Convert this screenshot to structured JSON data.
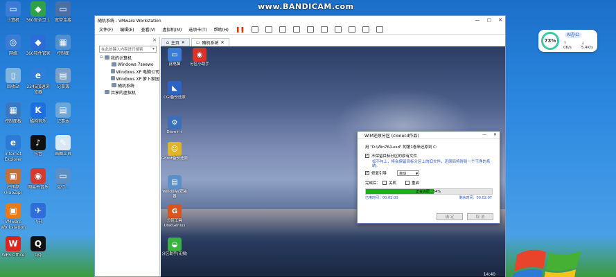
{
  "watermark": "www.BANDICAM.com",
  "desktop_icons": [
    {
      "label": "计算机",
      "icon": "computer-icon",
      "color": "#3a7bd5",
      "glyph": "▭"
    },
    {
      "label": "360安全卫士",
      "icon": "360-security-icon",
      "color": "#2fa14a",
      "glyph": "◆"
    },
    {
      "label": "宽带连接",
      "icon": "broadband-icon",
      "color": "#4a6fa5",
      "glyph": "▭"
    },
    {
      "label": "网络",
      "icon": "network-icon",
      "color": "#3a7bd5",
      "glyph": "◎"
    },
    {
      "label": "360软件管家",
      "icon": "360-software-icon",
      "color": "#2b6cd6",
      "glyph": "◆"
    },
    {
      "label": "控制面",
      "icon": "control-panel-icon",
      "color": "#4f8fd0",
      "glyph": "▦"
    },
    {
      "label": "回收站",
      "icon": "recycle-bin-icon",
      "color": "#7fb3e0",
      "glyph": "▯"
    },
    {
      "label": "2345加速浏览器",
      "icon": "browser-2345-icon",
      "color": "#2e7fd8",
      "glyph": "e"
    },
    {
      "label": "记事簿",
      "icon": "notebook-icon",
      "color": "#7aa0c8",
      "glyph": "▤"
    },
    {
      "label": "控制面板",
      "icon": "control-panel-icon",
      "color": "#3c78c2",
      "glyph": "▦"
    },
    {
      "label": "酷狗音乐",
      "icon": "kugou-icon",
      "color": "#1d6fe0",
      "glyph": "K"
    },
    {
      "label": "记事本",
      "icon": "notepad-icon",
      "color": "#6aa6d8",
      "glyph": "▤"
    },
    {
      "label": "Internet Explorer",
      "icon": "ie-icon",
      "color": "#2b7bd6",
      "glyph": "e"
    },
    {
      "label": "抖音",
      "icon": "tiktok-icon",
      "color": "#111111",
      "glyph": "♪"
    },
    {
      "label": "画图工具",
      "icon": "paint-icon",
      "color": "#d9e8f5",
      "glyph": "✎"
    },
    {
      "label": "好压缩(HaoZip)",
      "icon": "haozip-icon",
      "color": "#c2703a",
      "glyph": "▣"
    },
    {
      "label": "网易云音乐",
      "icon": "netease-music-icon",
      "color": "#d33a31",
      "glyph": "◉"
    },
    {
      "label": "运行…",
      "icon": "run-icon",
      "color": "#5a8fc8",
      "glyph": "▭"
    },
    {
      "label": "VMware Workstation",
      "icon": "vmware-icon",
      "color": "#e97a1a",
      "glyph": "▣"
    },
    {
      "label": "飞书",
      "icon": "feishu-icon",
      "color": "#2f6ed8",
      "glyph": "✈"
    },
    {
      "label": "WPS Office",
      "icon": "wps-icon",
      "color": "#d5271f",
      "glyph": "W"
    },
    {
      "label": "QQ",
      "icon": "qq-icon",
      "color": "#111111",
      "glyph": "Q"
    }
  ],
  "vmware": {
    "title": "随机系统 - VMware Workstation",
    "menu": [
      "文件(F)",
      "编辑(E)",
      "查看(V)",
      "虚拟机(M)",
      "选项卡(T)",
      "帮助(H)"
    ],
    "tabs": [
      "主页",
      "随机系统"
    ],
    "library": {
      "search_placeholder": "在此处键入内容进行搜索",
      "tree": [
        {
          "label": "我的计算机",
          "level": 0,
          "twisty": "⊟"
        },
        {
          "label": "Windows 7seewo",
          "level": 1,
          "twisty": ""
        },
        {
          "label": "Windows XP 电脑公司",
          "level": 1,
          "twisty": ""
        },
        {
          "label": "Windows XP 萝卜家园",
          "level": 1,
          "twisty": ""
        },
        {
          "label": "随机系统",
          "level": 1,
          "twisty": ""
        },
        {
          "label": "共享的虚拟机",
          "level": 0,
          "twisty": ""
        }
      ]
    }
  },
  "guest_icons": [
    {
      "label": "此电脑",
      "icon": "this-pc-icon",
      "color": "#3a7bd5",
      "glyph": "▭"
    },
    {
      "label": "分区小助手",
      "icon": "partition-assistant-icon",
      "color": "#d8332b",
      "glyph": "◉"
    },
    {
      "label": "CGI备份还原",
      "icon": "cgi-backup-icon",
      "color": "#2c64c4",
      "glyph": "◣"
    },
    {
      "label": "Dism++",
      "icon": "dism-icon",
      "color": "#3d6fb8",
      "glyph": "⚙"
    },
    {
      "label": "Ghost备份还原",
      "icon": "ghost-icon",
      "color": "#e0b52a",
      "glyph": "☺"
    },
    {
      "label": "Windows安装器",
      "icon": "windows-installer-icon",
      "color": "#5a8fc8",
      "glyph": "▤"
    },
    {
      "label": "分区工具DiskGenius",
      "icon": "diskgenius-icon",
      "color": "#d9551f",
      "glyph": "G"
    },
    {
      "label": "分区助手(无损)",
      "icon": "partition-lossless-icon",
      "color": "#3bb045",
      "glyph": "◒"
    }
  ],
  "wim": {
    "title": "WIM还原分区 (clonecd作品)",
    "line1": "用 \"D:\\Win764.esd\" 的第1卷来还原到 C:",
    "opt1": "不保留目标分区的原有文件",
    "opt1_note": "如不勾上，将会保留目标分区上的旧文件，还原后将得到一个干净的系统。",
    "opt2": "修复引导",
    "boot_mode": "自动",
    "after_label": "完成后：",
    "opt_shutdown": "关机",
    "opt_restart": "重启",
    "progress": 0.54,
    "progress_text": "正在还原…54%",
    "elapsed": "已用时间：00:02:00",
    "remaining": "剩余时间：00:02:07",
    "btn_ok": "确 定",
    "btn_cancel": "取 消"
  },
  "guest_clock": "14:40",
  "widget": {
    "percent": "73%",
    "ai_label": "AI办公",
    "upload": "↑ 0K/s",
    "download": "↓ 5.4K/s"
  }
}
